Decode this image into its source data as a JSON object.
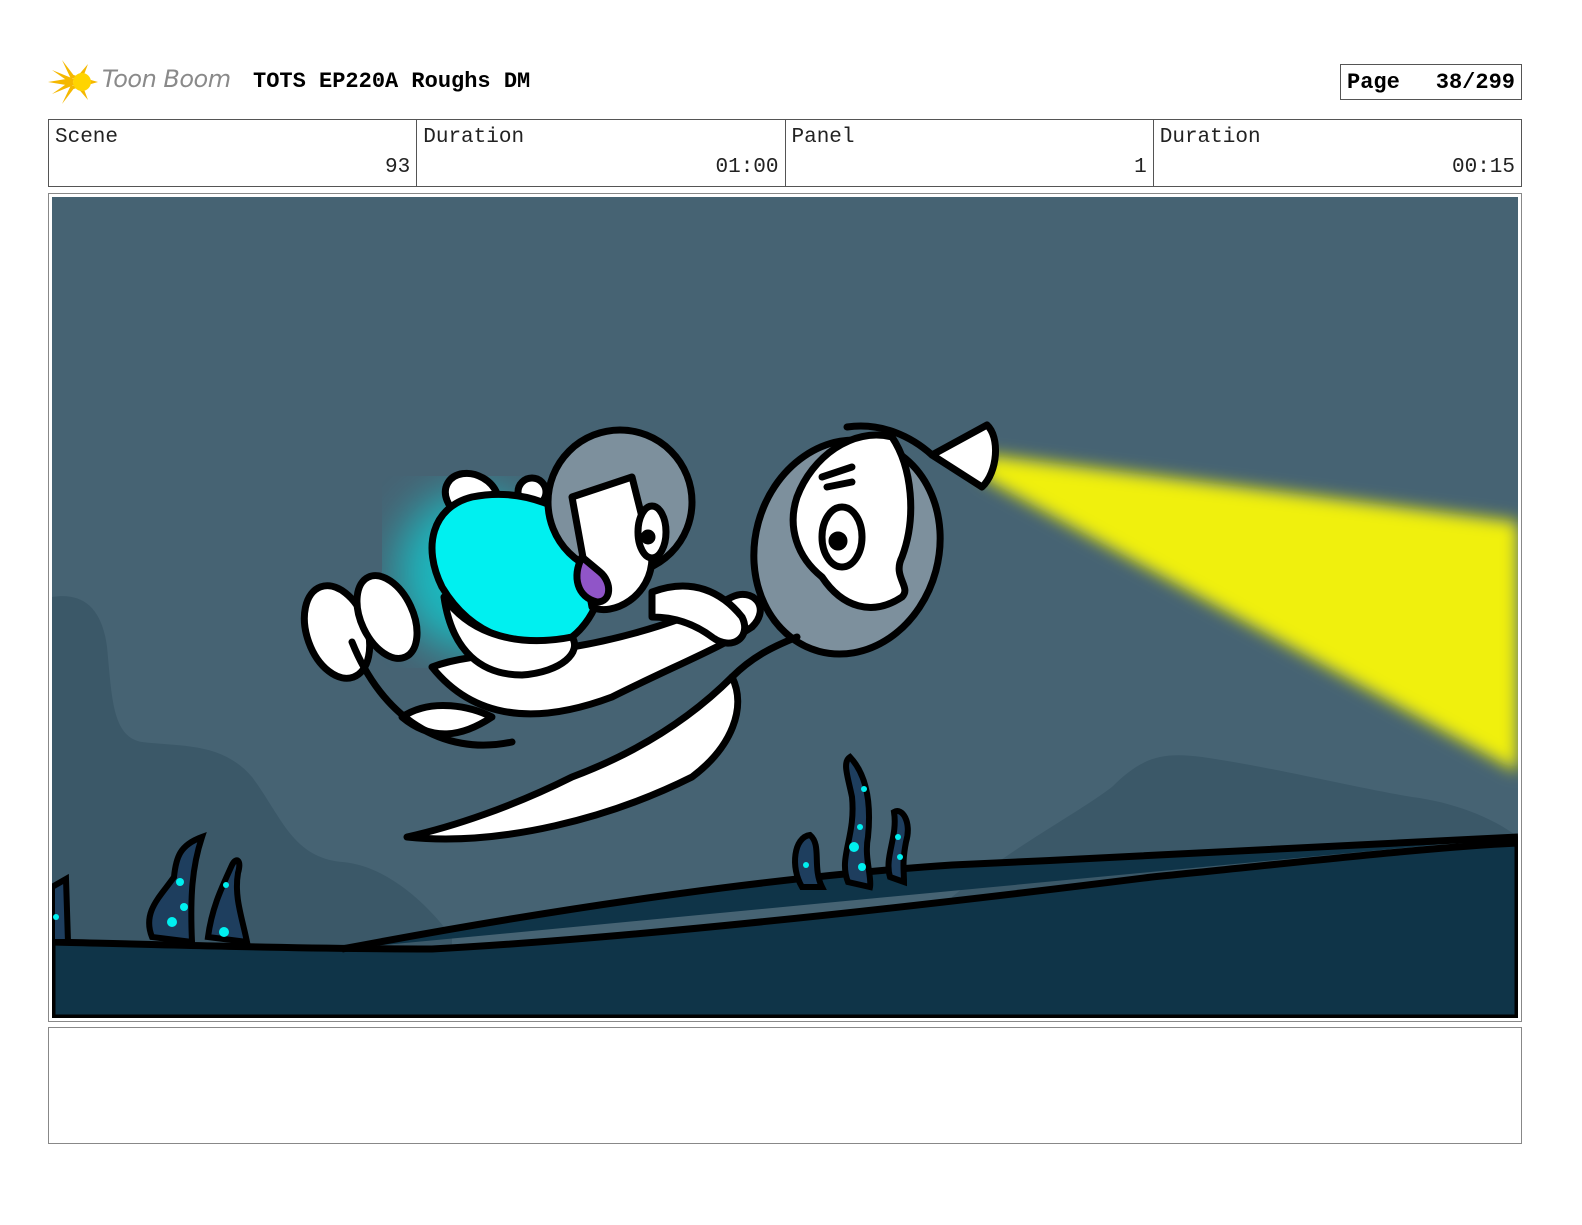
{
  "header": {
    "brand": "Toon Boom",
    "doc_title": "TOTS EP220A Roughs DM",
    "page_label": "Page",
    "page_value": "38/299"
  },
  "info": {
    "scene_label": "Scene",
    "scene_value": "93",
    "scene_duration_label": "Duration",
    "scene_duration_value": "01:00",
    "panel_label": "Panel",
    "panel_value": "1",
    "panel_duration_label": "Duration",
    "panel_duration_value": "00:15"
  },
  "notes": {
    "text": ""
  },
  "colors": {
    "sky": "#466373",
    "hills": "#3b5868",
    "seafloor": "#0f3448",
    "beam": "#f0f00a",
    "glow": "#00f0f0"
  },
  "icons": {
    "logo": "starburst-logo-icon"
  }
}
